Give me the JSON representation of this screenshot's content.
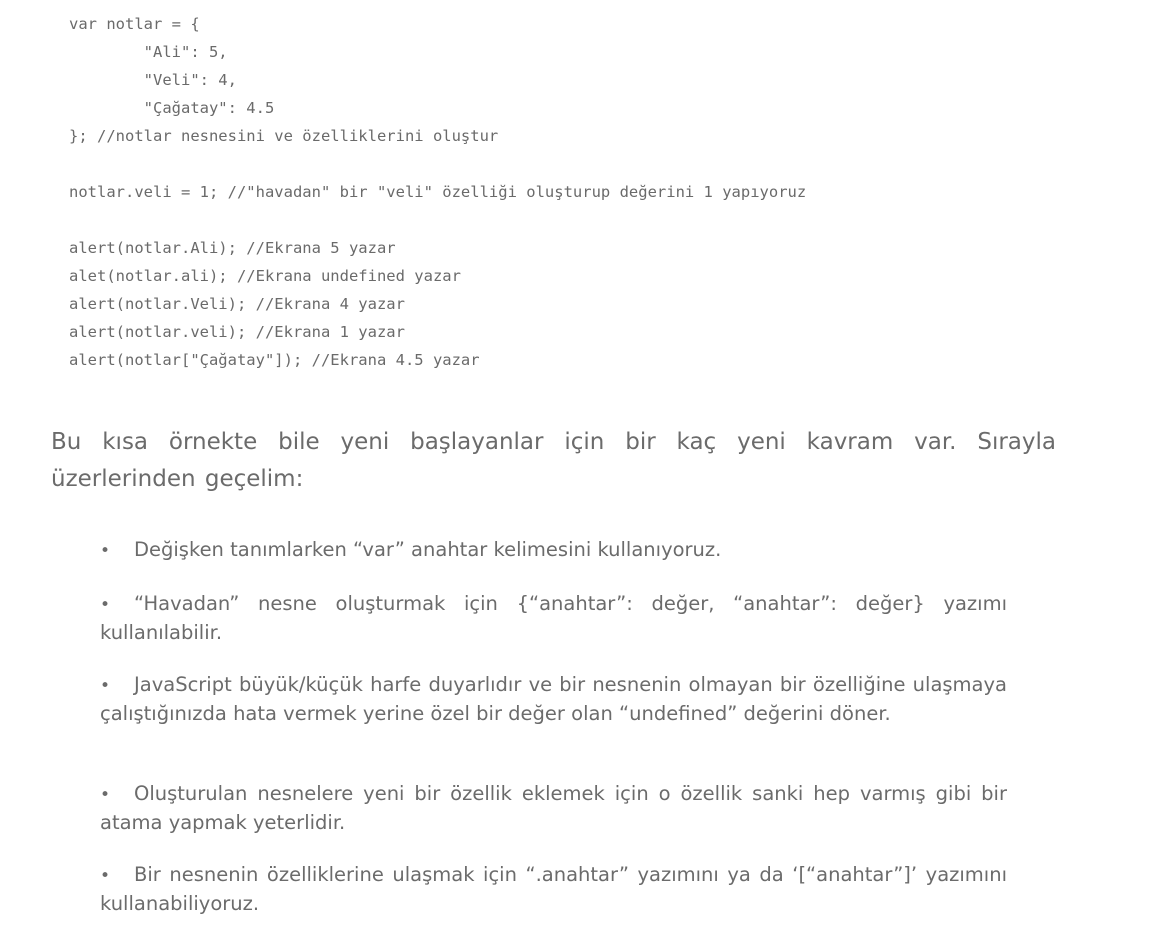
{
  "code": {
    "lines": [
      "var notlar = {",
      "        \"Ali\": 5,",
      "        \"Veli\": 4,",
      "        \"Çağatay\": 4.5",
      "}; //notlar nesnesini ve özelliklerini oluştur",
      "",
      "notlar.veli = 1; //\"havadan\" bir \"veli\" özelliği oluşturup değerini 1 yapıyoruz",
      "",
      "alert(notlar.Ali); //Ekrana 5 yazar",
      "alet(notlar.ali); //Ekrana undefined yazar",
      "alert(notlar.Veli); //Ekrana 4 yazar",
      "alert(notlar.veli); //Ekrana 1 yazar",
      "alert(notlar[\"Çağatay\"]); //Ekrana 4.5 yazar"
    ]
  },
  "intro": {
    "text": "Bu kısa örnekte bile yeni başlayanlar için bir kaç yeni kavram var. Sırayla üzerlerinden geçelim:"
  },
  "bullets": [
    {
      "text": "Değişken tanımlarken “var” anahtar kelimesini kullanıyoruz."
    },
    {
      "text": "“Havadan” nesne oluşturmak için {“anahtar”: değer, “anahtar”: değer} yazımı kullanılabilir."
    },
    {
      "text": "JavaScript büyük/küçük harfe duyarlıdır ve bir nesnenin olmayan bir özelliğine ulaşmaya çalıştığınızda hata vermek yerine özel bir değer olan “undefined” değerini döner."
    },
    {
      "text": "Oluşturulan nesnelere yeni bir özellik eklemek için o özellik sanki hep varmış gibi bir atama yapmak yeterlidir."
    },
    {
      "text": "Bir nesnenin özelliklerine ulaşmak için “.anahtar” yazımını ya da ‘[“anahtar”]’ yazımını kullanabiliyoruz."
    }
  ]
}
